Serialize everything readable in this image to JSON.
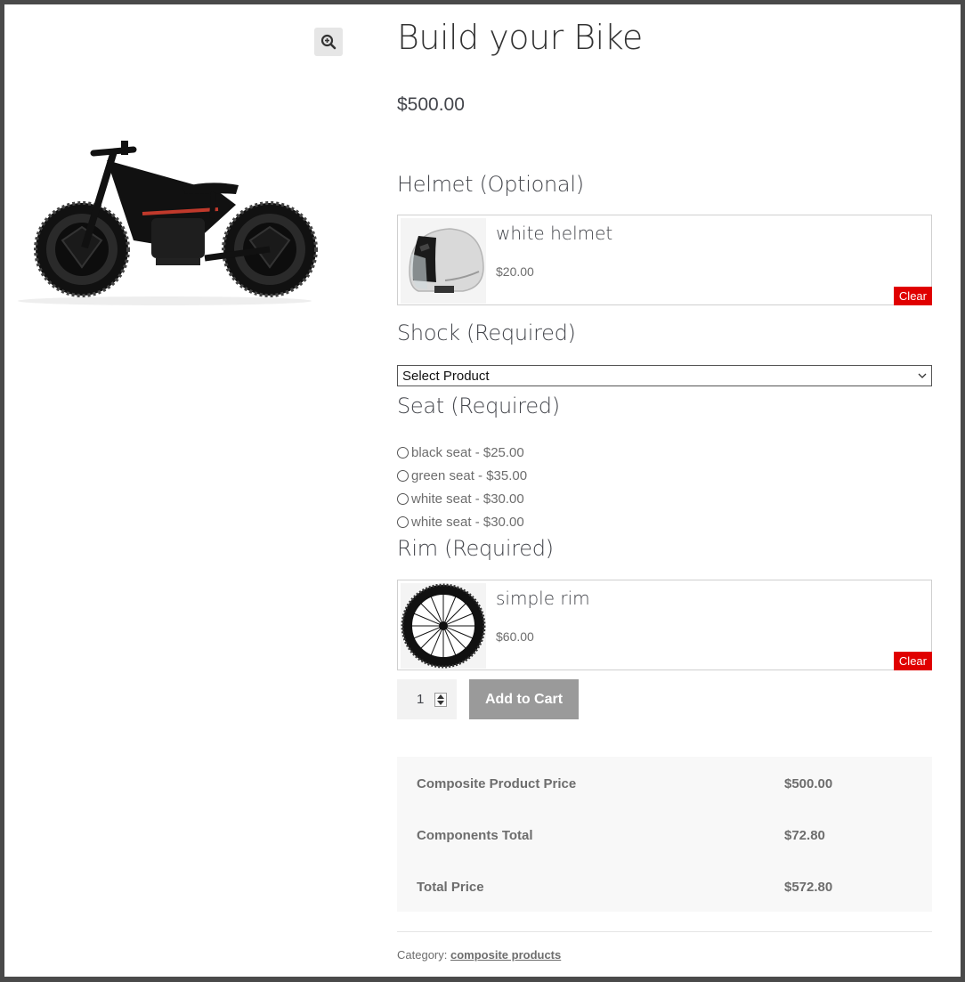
{
  "product": {
    "title": "Build your Bike",
    "price": "$500.00",
    "image_icon": "kids-balance-bike-image",
    "zoom_icon": "zoom-in-icon"
  },
  "sections": {
    "helmet": {
      "heading": "Helmet (Optional)",
      "selected": {
        "name": "white helmet",
        "price": "$20.00",
        "icon": "helmet-image"
      },
      "clear_label": "Clear"
    },
    "shock": {
      "heading": "Shock (Required)",
      "select_value": "Select Product"
    },
    "seat": {
      "heading": "Seat (Required)",
      "options": [
        "black seat - $25.00",
        "green seat - $35.00",
        "white seat - $30.00",
        "white seat - $30.00"
      ]
    },
    "rim": {
      "heading": "Rim (Required)",
      "selected": {
        "name": "simple rim",
        "price": "$60.00",
        "icon": "wheel-rim-image"
      },
      "clear_label": "Clear"
    }
  },
  "cart": {
    "quantity": "1",
    "add_label": "Add to Cart"
  },
  "totals": {
    "rows": [
      {
        "label": "Composite Product Price",
        "value": "$500.00"
      },
      {
        "label": "Components Total",
        "value": "$72.80"
      },
      {
        "label": "Total Price",
        "value": "$572.80"
      }
    ]
  },
  "meta": {
    "category_label": "Category:",
    "category_link": "composite products"
  },
  "colors": {
    "clear_red": "#e00000",
    "button_gray": "#9a9a9a",
    "totals_bg": "#f8f8f8"
  }
}
